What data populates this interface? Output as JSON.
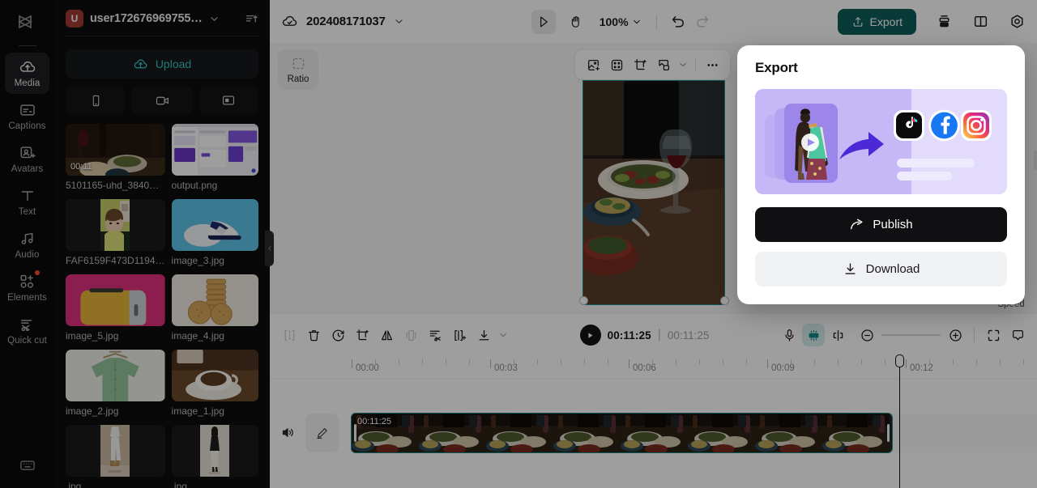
{
  "app": {
    "logo_icon": "capcut-logo-icon"
  },
  "rail": {
    "items": [
      {
        "label": "Media",
        "icon": "cloud-upload-icon",
        "active": true,
        "badge": false
      },
      {
        "label": "Captions",
        "icon": "captions-icon",
        "active": false,
        "badge": false
      },
      {
        "label": "Avatars",
        "icon": "avatar-person-icon",
        "active": false,
        "badge": false
      },
      {
        "label": "Text",
        "icon": "text-t-icon",
        "active": false,
        "badge": false
      },
      {
        "label": "Audio",
        "icon": "music-note-icon",
        "active": false,
        "badge": false
      },
      {
        "label": "Elements",
        "icon": "shapes-plus-icon",
        "active": false,
        "badge": true
      },
      {
        "label": "Quick cut",
        "icon": "quick-cut-scissors-icon",
        "active": false,
        "badge": false
      }
    ],
    "bottom_icon": "keyboard-shortcuts-icon"
  },
  "media_panel": {
    "avatar_initial": "U",
    "username": "user172676969755…",
    "chevron_icon": "chevron-down-icon",
    "sort_icon": "sort-ascending-icon",
    "upload_label": "Upload",
    "upload_icon": "cloud-upload-icon",
    "source_buttons": [
      {
        "icon": "phone-icon",
        "name": "import-from-phone"
      },
      {
        "icon": "camera-record-icon",
        "name": "record-video"
      },
      {
        "icon": "screen-record-icon",
        "name": "record-screen"
      }
    ],
    "collapse_icon": "chevron-left-icon",
    "files": [
      {
        "name": "5101165-uhd_3840…",
        "duration": "00:11",
        "kind": "video",
        "theme": "dinner"
      },
      {
        "name": "output.png",
        "duration": "",
        "kind": "image",
        "theme": "screenshot"
      },
      {
        "name": "FAF6159F473D1194…",
        "duration": "",
        "kind": "image",
        "theme": "portrait"
      },
      {
        "name": "image_3.jpg",
        "duration": "",
        "kind": "image",
        "theme": "sneaker"
      },
      {
        "name": "image_5.jpg",
        "duration": "",
        "kind": "image",
        "theme": "toaster"
      },
      {
        "name": "image_4.jpg",
        "duration": "",
        "kind": "image",
        "theme": "biscuit"
      },
      {
        "name": "image_2.jpg",
        "duration": "",
        "kind": "image",
        "theme": "shirt"
      },
      {
        "name": "image_1.jpg",
        "duration": "",
        "kind": "image",
        "theme": "coffee"
      },
      {
        "name": ".jpg",
        "duration": "",
        "kind": "image",
        "theme": "model1"
      },
      {
        "name": ".jpg",
        "duration": "",
        "kind": "image",
        "theme": "model2"
      }
    ]
  },
  "topbar": {
    "cloud_icon": "cloud-saved-icon",
    "project_name": "202408171037",
    "project_chevron_icon": "chevron-down-icon",
    "select_tool_icon": "cursor-arrow-icon",
    "hand_tool_icon": "hand-pan-icon",
    "zoom_level": "100%",
    "zoom_chevron_icon": "chevron-down-icon",
    "undo_icon": "undo-arrow-icon",
    "redo_icon": "redo-arrow-icon",
    "export_label": "Export",
    "export_icon": "upload-share-icon",
    "export_color": "#0d5f5b",
    "layers_icon": "layers-stack-icon",
    "layout_icon": "split-layout-icon",
    "settings_icon": "gear-settings-icon"
  },
  "canvas": {
    "ratio_label": "Ratio",
    "ratio_icon": "aspect-ratio-dashed-icon",
    "float_tools": [
      {
        "icon": "replace-media-icon",
        "name": "replace-media-button"
      },
      {
        "icon": "auto-fit-icon",
        "name": "auto-fit-button"
      },
      {
        "icon": "crop-icon",
        "name": "crop-button"
      },
      {
        "icon": "remove-background-icon",
        "name": "remove-background-button"
      },
      {
        "icon": "chevron-down-icon",
        "name": "remove-background-options"
      },
      {
        "icon": "more-dots-icon",
        "name": "more-options-button"
      }
    ],
    "selection_color": "#1a8f8a",
    "rotate_icon": "rotate-handle-icon"
  },
  "timeline_toolbar": {
    "tools": [
      {
        "icon": "split-clip-icon",
        "name": "split-button",
        "disabled": true
      },
      {
        "icon": "delete-trash-icon",
        "name": "delete-button",
        "disabled": false
      },
      {
        "icon": "speed-gauge-icon",
        "name": "speed-button",
        "disabled": false
      },
      {
        "icon": "crop-icon",
        "name": "crop-button",
        "disabled": false
      },
      {
        "icon": "mirror-flip-icon",
        "name": "mirror-button",
        "disabled": false
      },
      {
        "icon": "freeze-frame-icon",
        "name": "freeze-button",
        "disabled": true
      },
      {
        "icon": "auto-cut-icon",
        "name": "auto-cut-button",
        "disabled": false
      },
      {
        "icon": "keyframe-icon",
        "name": "keyframe-button",
        "disabled": false
      },
      {
        "icon": "download-clip-icon",
        "name": "download-clip-button",
        "disabled": false
      },
      {
        "icon": "chevron-down-icon",
        "name": "download-options",
        "disabled": false
      }
    ],
    "play_icon": "play-triangle-icon",
    "current_time": "00:11:25",
    "total_time": "00:11:25",
    "right_tools": [
      {
        "icon": "microphone-icon",
        "name": "voiceover-button",
        "active": false
      },
      {
        "icon": "auto-subtitle-icon",
        "name": "auto-subtitle-button",
        "active": true
      },
      {
        "icon": "adjust-clip-icon",
        "name": "trim-edges-button",
        "active": false
      }
    ],
    "zoom_out_icon": "minus-circle-icon",
    "zoom_in_icon": "plus-circle-icon",
    "fit_icon": "fit-to-screen-icon",
    "preview_icon": "preview-monitor-icon",
    "speed_tooltip": "Speed"
  },
  "timeline": {
    "ticks": [
      "00:00",
      "00:03",
      "00:06",
      "00:09",
      "00:12"
    ],
    "playhead_time": "00:12",
    "track": {
      "volume_icon": "speaker-volume-icon",
      "edit_icon": "pencil-edit-icon",
      "clip_duration": "00:11:25",
      "clip_outline_color": "#1a8f8a"
    }
  },
  "export_panel": {
    "title": "Export",
    "publish_label": "Publish",
    "publish_icon": "share-arrow-icon",
    "download_label": "Download",
    "download_icon": "download-arrow-icon",
    "banner": {
      "platforms": [
        "tiktok-icon",
        "facebook-icon",
        "instagram-icon"
      ],
      "background": "#c9bcf8",
      "arrow_color": "#4b29d6"
    }
  }
}
